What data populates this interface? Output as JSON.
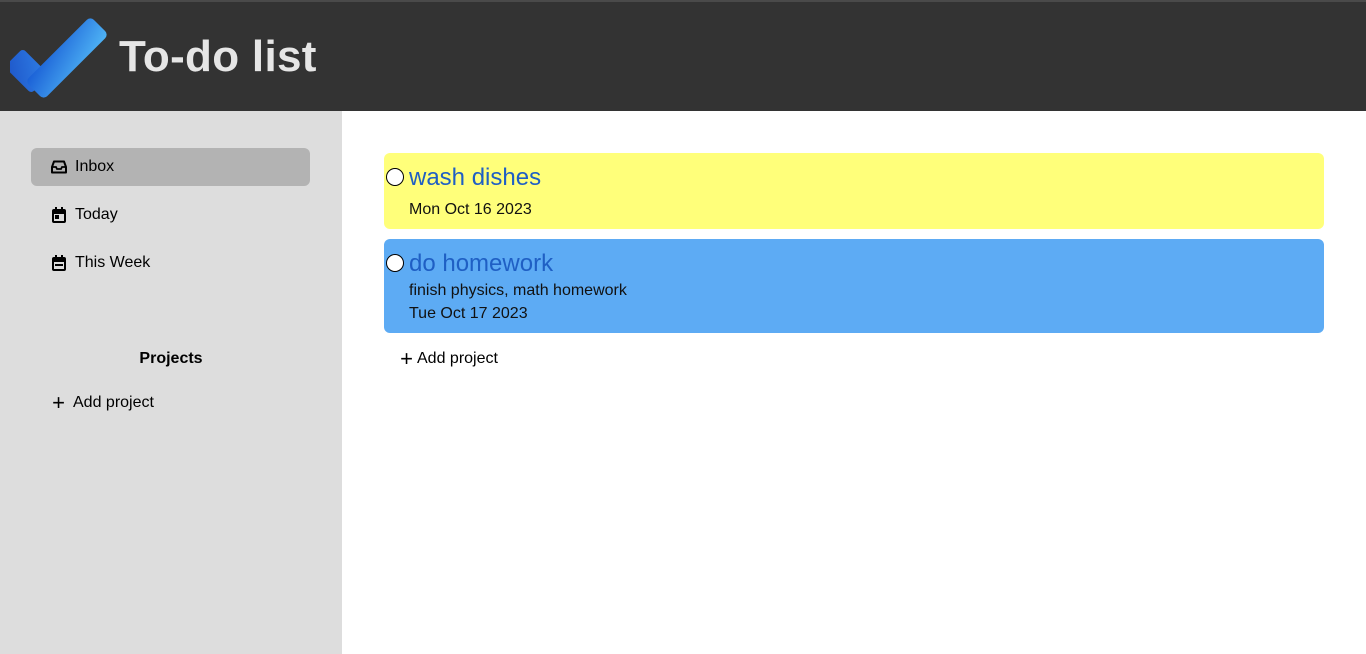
{
  "header": {
    "title": "To-do list",
    "logo_icon": "checkmark-logo-icon",
    "bg_color": "#333333"
  },
  "sidebar": {
    "items": [
      {
        "label": "Inbox",
        "icon": "inbox-icon",
        "active": true
      },
      {
        "label": "Today",
        "icon": "calendar-day-icon",
        "active": false
      },
      {
        "label": "This Week",
        "icon": "calendar-week-icon",
        "active": false
      }
    ],
    "projects_title": "Projects",
    "add_project_label": "Add project"
  },
  "main": {
    "tasks": [
      {
        "title": "wash dishes",
        "description": "",
        "date": "Mon Oct 16 2023",
        "color": "#ffff7a"
      },
      {
        "title": "do homework",
        "description": "finish physics, math homework",
        "date": "Tue Oct 17 2023",
        "color": "#5dabf4"
      }
    ],
    "add_project_label": "Add project"
  }
}
